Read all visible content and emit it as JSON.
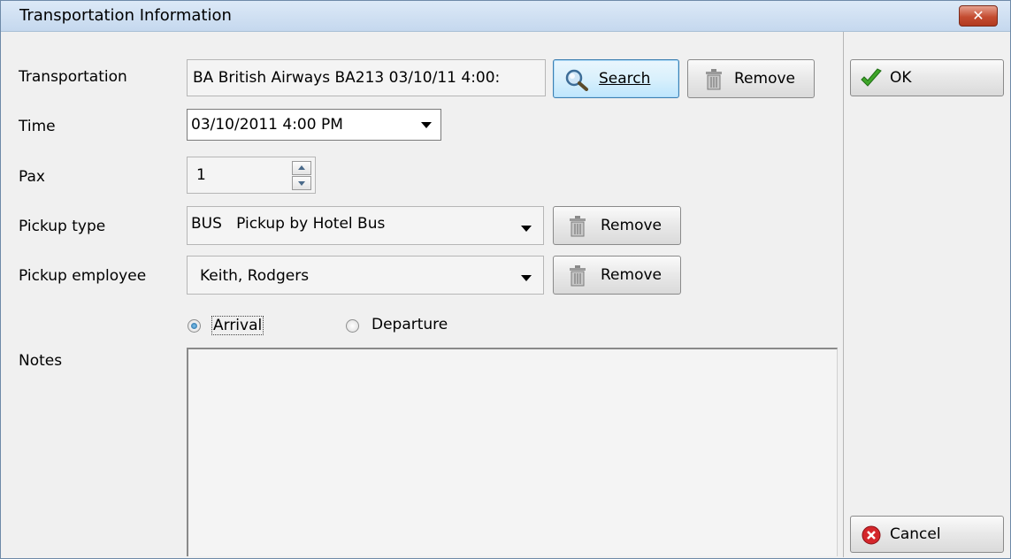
{
  "window": {
    "title": "Transportation Information",
    "close_glyph": "✕"
  },
  "labels": {
    "transportation": "Transportation",
    "time": "Time",
    "pax": "Pax",
    "pickup_type": "Pickup type",
    "pickup_employee": "Pickup employee",
    "notes": "Notes"
  },
  "fields": {
    "transportation_value": "BA British Airways BA213 03/10/11 4:00:",
    "time_value": "03/10/2011 4:00 PM",
    "pax_value": "1",
    "pickup_type_value": "BUS   Pickup by Hotel Bus",
    "pickup_employee_value": "Keith, Rodgers",
    "notes_value": ""
  },
  "buttons": {
    "search": "Search",
    "remove_transport": "Remove",
    "remove_pickup_type": "Remove",
    "remove_employee": "Remove",
    "ok": "OK",
    "cancel": "Cancel"
  },
  "radios": {
    "arrival": "Arrival",
    "departure": "Departure",
    "selected": "arrival"
  },
  "icons": {
    "search": "magnifier-icon",
    "remove": "trash-icon",
    "ok": "checkmark-icon",
    "cancel": "cancel-icon",
    "close": "close-icon"
  },
  "colors": {
    "title_bar": "#c5d8ee",
    "close_button": "#c44d31",
    "ok_check": "#3fa62a",
    "cancel_red": "#d4262b"
  }
}
